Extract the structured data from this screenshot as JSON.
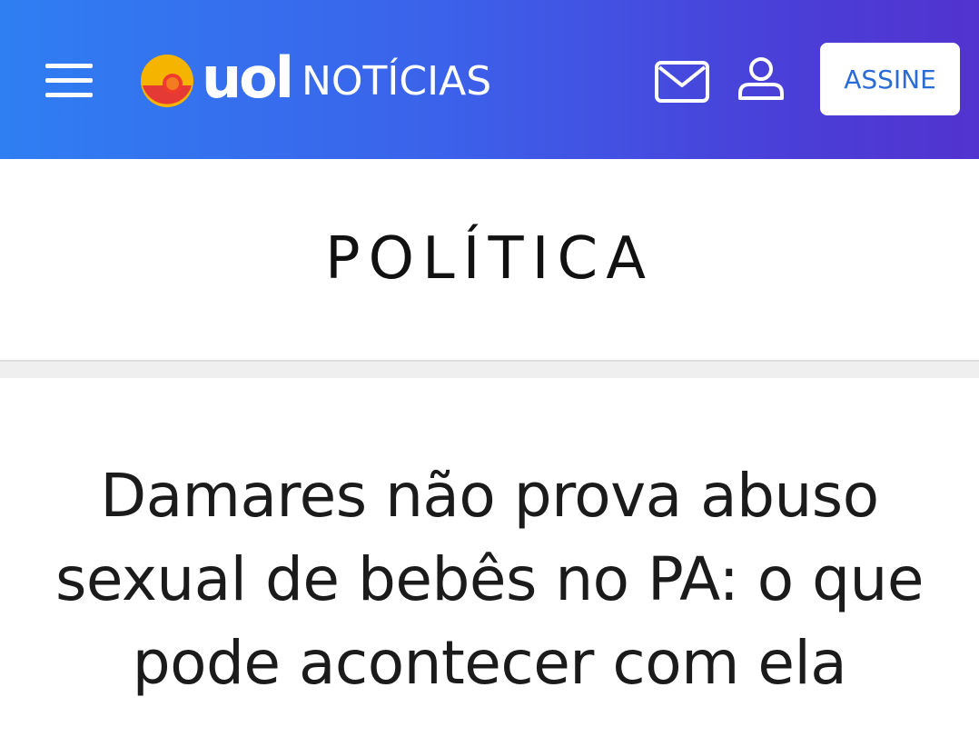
{
  "header": {
    "brand": "uol",
    "section": "NOTÍCIAS",
    "subscribe_label": "ASSINE",
    "icons": [
      "menu-icon",
      "uol-logo-icon",
      "mail-icon",
      "user-icon"
    ],
    "colors": {
      "gradient_start": "#2f7ef2",
      "gradient_end": "#5233cf",
      "button_text": "#2a6bd6"
    }
  },
  "article": {
    "category": "POLÍTICA",
    "headline": "Damares não prova abuso sexual de bebês no PA: o que pode acontecer com ela"
  }
}
